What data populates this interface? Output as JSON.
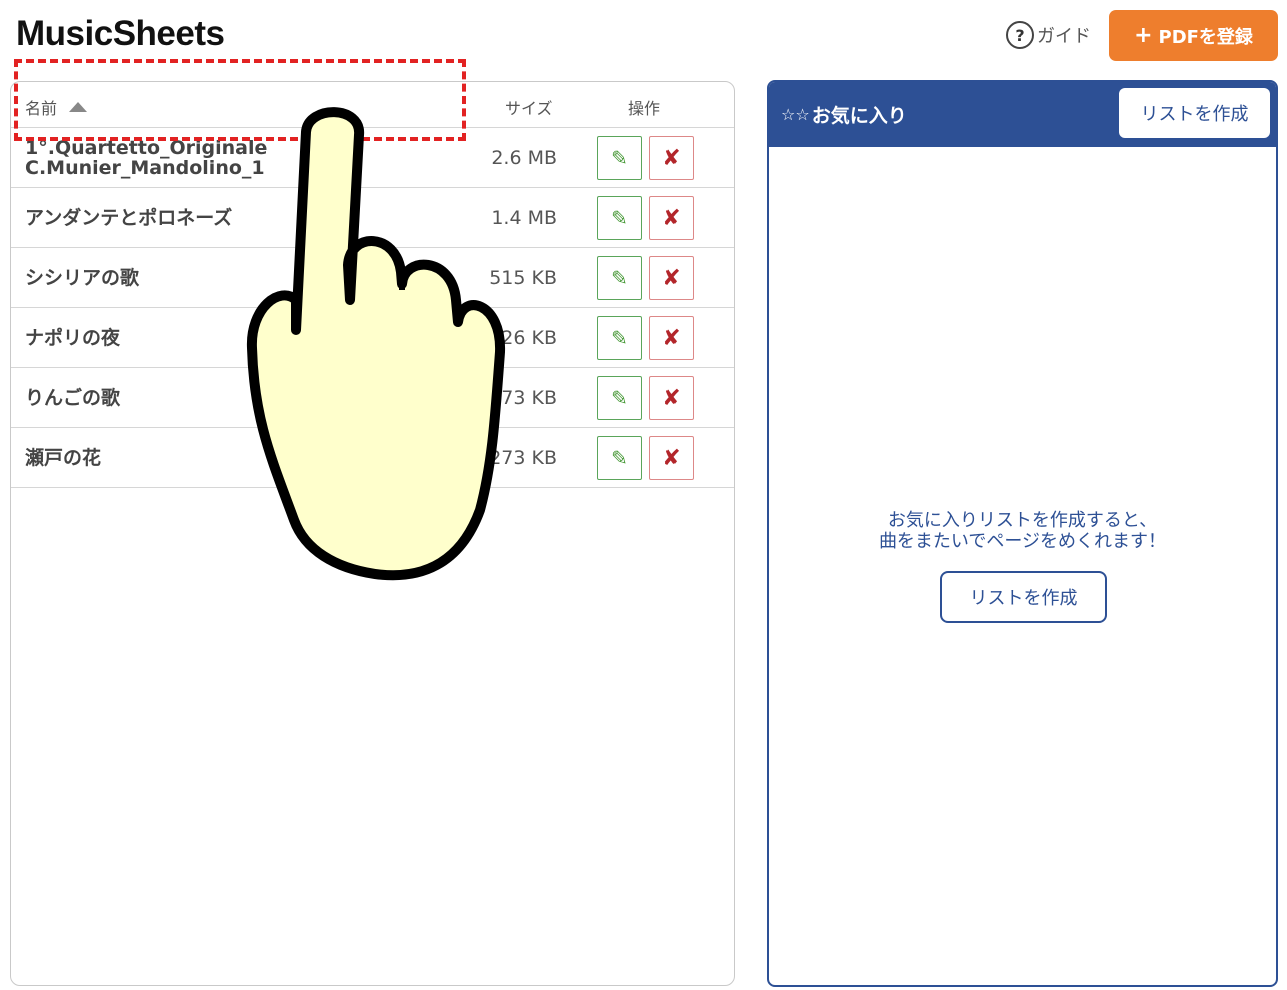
{
  "app": {
    "title": "MusicSheets"
  },
  "header": {
    "guide_label": "ガイド",
    "guide_icon_glyph": "?",
    "register_plus": "+",
    "register_label": "PDFを登録",
    "register_color": "#ee7e2d"
  },
  "file_list": {
    "columns": {
      "name": "名前",
      "size": "サイズ",
      "ops": "操作"
    },
    "sort": {
      "column": "name",
      "direction": "ascending"
    },
    "rows": [
      {
        "name": "1°.Quartetto_Originale\nC.Munier_Mandolino_1",
        "size": "2.6 MB"
      },
      {
        "name": "アンダンテとポロネーズ",
        "size": "1.4 MB"
      },
      {
        "name": "シシリアの歌",
        "size": "515 KB"
      },
      {
        "name": "ナポリの夜",
        "size": "426 KB"
      },
      {
        "name": "りんごの歌",
        "size": "273 KB"
      },
      {
        "name": "瀬戸の花",
        "size": "273 KB"
      }
    ],
    "edit_glyph": "✎",
    "delete_glyph": "✘"
  },
  "favorites": {
    "stars": "☆☆",
    "title": "お気に入り",
    "create_list_label": "リストを作成",
    "empty_message": "お気に入りリストを作成すると、\n曲をまたいでページをめくれます！",
    "create_list_center_label": "リストを作成",
    "accent_color": "#2d5095"
  },
  "overlay": {
    "highlight_color": "#e22222",
    "hand_color": "#ffffcc"
  }
}
